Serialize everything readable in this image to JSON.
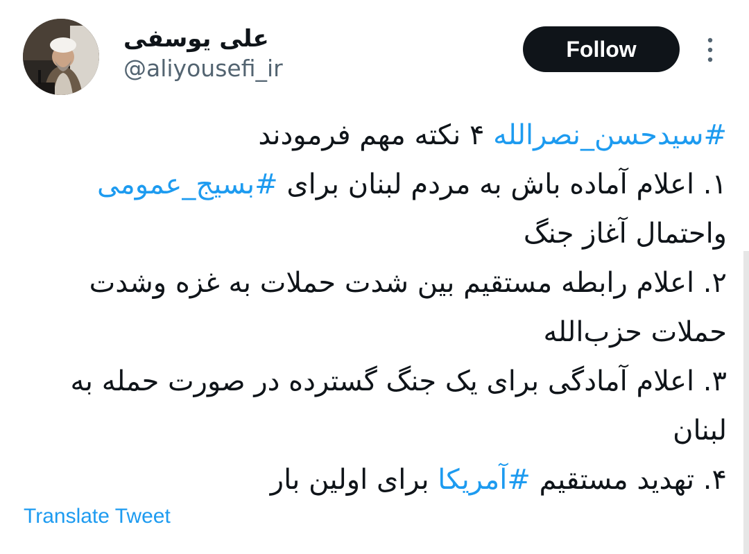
{
  "author": {
    "display_name": "علی یوسفی",
    "handle": "@aliyousefi_ir",
    "avatar_icon": "profile-photo-cleric-icon"
  },
  "header": {
    "follow_label": "Follow",
    "more_icon": "more-vertical-icon"
  },
  "tweet": {
    "lines": [
      [
        {
          "text": "#سیدحسن_نصرالله",
          "hashtag": true
        },
        {
          "text": " ۴ نکته مهم فرمودند",
          "hashtag": false
        }
      ],
      [
        {
          "text": "۱. اعلام آماده باش به مردم لبنان برای ",
          "hashtag": false
        },
        {
          "text": "#بسیج_عمومی",
          "hashtag": true
        }
      ],
      [
        {
          "text": "واحتمال آغاز جنگ",
          "hashtag": false
        }
      ],
      [
        {
          "text": "۲. اعلام رابطه مستقیم بین شدت حملات به غزه وشدت",
          "hashtag": false
        }
      ],
      [
        {
          "text": "حملات حزب‌الله",
          "hashtag": false
        }
      ],
      [
        {
          "text": "۳. اعلام آمادگی برای یک جنگ گسترده در صورت حمله به",
          "hashtag": false
        }
      ],
      [
        {
          "text": "لبنان",
          "hashtag": false
        }
      ],
      [
        {
          "text": "۴. تهدید مستقیم ",
          "hashtag": false
        },
        {
          "text": "#آمریکا",
          "hashtag": true
        },
        {
          "text": " برای اولین بار",
          "hashtag": false
        }
      ]
    ]
  },
  "footer": {
    "translate_label": "Translate Tweet"
  },
  "colors": {
    "link": "#1d9bf0",
    "text": "#0f1419",
    "secondary": "#536471",
    "button_bg": "#0f1419"
  }
}
